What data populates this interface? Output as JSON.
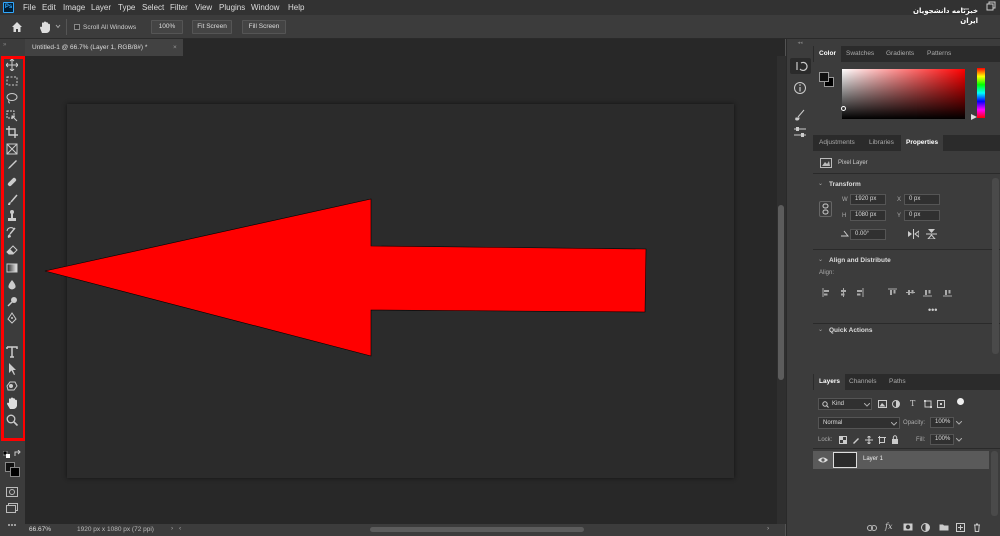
{
  "app": {
    "logo": "Ps"
  },
  "menu": [
    "File",
    "Edit",
    "Image",
    "Layer",
    "Type",
    "Select",
    "Filter",
    "View",
    "Plugins",
    "Window",
    "Help"
  ],
  "options": {
    "scroll_all": "Scroll All Windows",
    "zoom_pct": "100%",
    "fit": "Fit Screen",
    "fill": "Fill Screen"
  },
  "document": {
    "tab_title": "Untitled-1 @ 66.7% (Layer 1, RGB/8#) *"
  },
  "status": {
    "zoom": "66.67%",
    "doc_info": "1920 px x 1080 px (72 ppi)"
  },
  "tools": [
    "move-tool",
    "marquee-tool",
    "lasso-tool",
    "object-select-tool",
    "crop-tool",
    "frame-tool",
    "eyedropper-tool",
    "healing-brush-tool",
    "brush-tool",
    "clone-stamp-tool",
    "history-brush-tool",
    "eraser-tool",
    "gradient-tool",
    "blur-tool",
    "dodge-tool",
    "pen-tool",
    "type-tool",
    "path-selection-tool",
    "shape-tool",
    "hand-tool",
    "zoom-tool"
  ],
  "color_panel": {
    "tabs": [
      "Color",
      "Swatches",
      "Gradients",
      "Patterns"
    ],
    "active": "Color",
    "hue": "#ff0000"
  },
  "props_panel": {
    "tabs": [
      "Adjustments",
      "Libraries",
      "Properties"
    ],
    "active": "Properties",
    "layer_type": "Pixel Layer",
    "transform": {
      "title": "Transform",
      "w_label": "W",
      "w": "1920 px",
      "h_label": "H",
      "h": "1080 px",
      "x_label": "X",
      "x": "0 px",
      "y_label": "Y",
      "y": "0 px",
      "angle": "0.00°"
    },
    "align": {
      "title": "Align and Distribute",
      "label": "Align:"
    },
    "quick": {
      "title": "Quick Actions"
    }
  },
  "layers_panel": {
    "tabs": [
      "Layers",
      "Channels",
      "Paths"
    ],
    "active": "Layers",
    "filter": "Kind",
    "blend": "Normal",
    "opacity_label": "Opacity:",
    "opacity": "100%",
    "lock_label": "Lock:",
    "fill_label": "Fill:",
    "fill": "100%",
    "layers": [
      {
        "name": "Layer 1"
      }
    ]
  },
  "watermark": {
    "text": "خبرنامه دانشجویان ایران"
  },
  "colors": {
    "shape_fill": "#ff0000",
    "highlight": "#ff0000"
  }
}
